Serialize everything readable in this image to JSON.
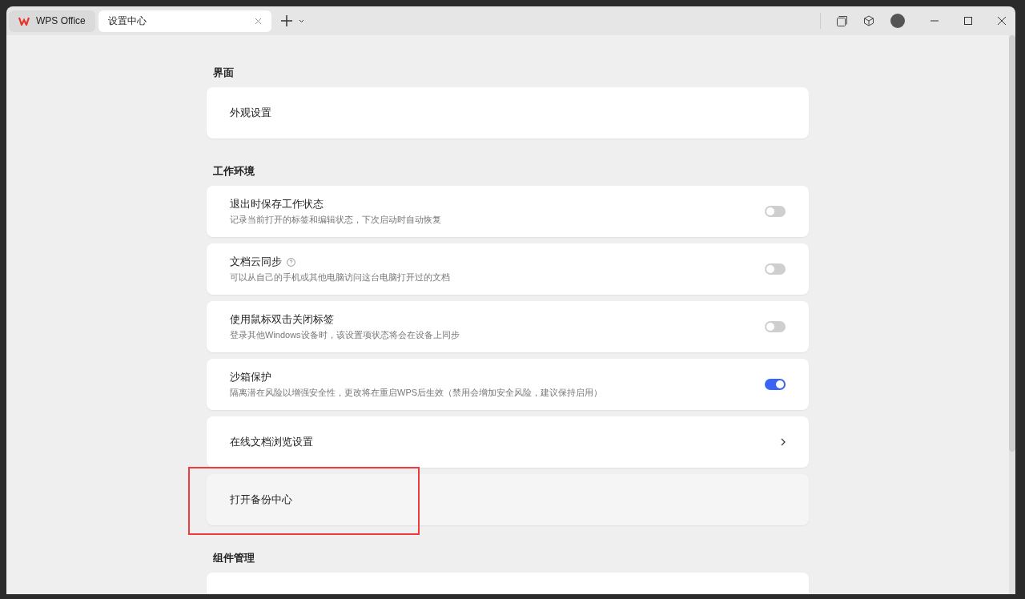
{
  "tabs": [
    {
      "label": "WPS Office",
      "kind": "home",
      "selected": false
    },
    {
      "label": "设置中心",
      "kind": "page",
      "selected": true
    }
  ],
  "sections": [
    {
      "title": "界面",
      "rows": [
        {
          "kind": "plain",
          "title": "外观设置",
          "highlighted": false
        }
      ]
    },
    {
      "title": "工作环境",
      "rows": [
        {
          "kind": "toggle",
          "title": "退出时保存工作状态",
          "description": "记录当前打开的标签和编辑状态，下次启动时自动恢复",
          "on": false,
          "help": false,
          "highlighted": false
        },
        {
          "kind": "toggle",
          "title": "文档云同步",
          "description": "可以从自己的手机或其他电脑访问这台电脑打开过的文档",
          "on": false,
          "help": true,
          "highlighted": false
        },
        {
          "kind": "toggle",
          "title": "使用鼠标双击关闭标签",
          "description": "登录其他Windows设备时，该设置项状态将会在设备上同步",
          "on": false,
          "help": false,
          "highlighted": false
        },
        {
          "kind": "toggle",
          "title": "沙箱保护",
          "description": "隔离潜在风险以增强安全性，更改将在重启WPS后生效（禁用会增加安全风险，建议保持启用）",
          "on": true,
          "help": false,
          "highlighted": false
        },
        {
          "kind": "link",
          "title": "在线文档浏览设置",
          "highlighted": false
        },
        {
          "kind": "plain",
          "title": "打开备份中心",
          "highlighted": true
        }
      ]
    },
    {
      "title": "组件管理",
      "rows": [
        {
          "kind": "plain",
          "highlighted": false
        }
      ]
    }
  ]
}
